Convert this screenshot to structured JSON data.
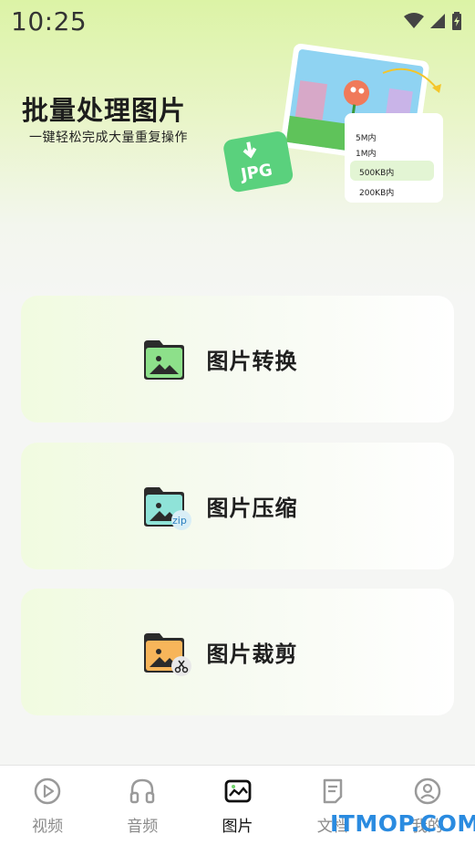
{
  "status_bar": {
    "time": "10:25"
  },
  "hero": {
    "title": "批量处理图片",
    "subtitle": "一键轻松完成大量重复操作",
    "badge_text": "JPG",
    "size_options": [
      "5M内",
      "1M内",
      "500KB内",
      "200KB内"
    ],
    "selected_option": "500KB内"
  },
  "features": [
    {
      "label": "图片转换",
      "icon": "image-folder-icon",
      "color": "#6fd36a"
    },
    {
      "label": "图片压缩",
      "icon": "image-zip-folder-icon",
      "color": "#67d6c9"
    },
    {
      "label": "图片裁剪",
      "icon": "image-scissors-folder-icon",
      "color": "#f5a53a"
    }
  ],
  "zip_badge": "zip",
  "nav": {
    "items": [
      {
        "label": "视频",
        "icon": "play-circle-icon"
      },
      {
        "label": "音频",
        "icon": "headphones-icon"
      },
      {
        "label": "图片",
        "icon": "image-icon"
      },
      {
        "label": "文档",
        "icon": "document-icon"
      },
      {
        "label": "我的",
        "icon": "profile-icon"
      }
    ],
    "active_index": 2
  },
  "watermark": "ITMOP.COM",
  "colors": {
    "accent": "#6fd36a",
    "hero_top": "#dcf3a6",
    "watermark": "#2a8be0"
  }
}
